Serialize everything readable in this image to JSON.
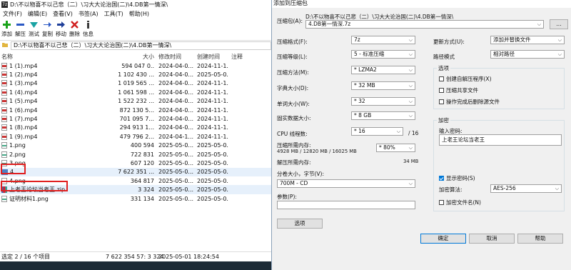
{
  "file_manager": {
    "title": "D:\\不以物喜不以己悲（二）\\习大大论治国(二)\\4.DB第一情深\\",
    "menu": [
      "文件(F)",
      "编辑(E)",
      "查看(V)",
      "书签(A)",
      "工具(T)",
      "帮助(H)"
    ],
    "toolbar": [
      {
        "label": "添加",
        "icon": "add-icon",
        "color": "#1aa31a"
      },
      {
        "label": "解压",
        "icon": "extract-icon",
        "color": "#2a58c4"
      },
      {
        "label": "测试",
        "icon": "test-icon",
        "color": "#1aa3a3"
      },
      {
        "label": "复制",
        "icon": "copy-icon",
        "color": "#2a58c4"
      },
      {
        "label": "移动",
        "icon": "move-icon",
        "color": "#2a58c4"
      },
      {
        "label": "删除",
        "icon": "delete-icon",
        "color": "#d01f1f"
      },
      {
        "label": "信息",
        "icon": "info-icon",
        "color": "#3a3a3a"
      }
    ],
    "path": "D:\\不以物喜不以己悲（二）\\习大大论治国(二)\\4.DB第一情深\\",
    "columns": {
      "name": "名称",
      "size": "大小",
      "modified": "修改时间",
      "created": "创建时间",
      "comment": "注释"
    },
    "rows": [
      {
        "name": "1 (1).mp4",
        "type": "mp4",
        "size": "594 047 0..",
        "modified": "2024-04-0...",
        "created": "2024-11-1..."
      },
      {
        "name": "1 (2).mp4",
        "type": "mp4",
        "size": "1 102 430 ...",
        "modified": "2024-04-0...",
        "created": "2025-05-0..."
      },
      {
        "name": "1 (3).mp4",
        "type": "mp4",
        "size": "1 019 565 ...",
        "modified": "2024-04-0...",
        "created": "2024-11-1..."
      },
      {
        "name": "1 (4).mp4",
        "type": "mp4",
        "size": "1 061 598 ...",
        "modified": "2024-04-0...",
        "created": "2024-11-1..."
      },
      {
        "name": "1 (5).mp4",
        "type": "mp4",
        "size": "1 522 232 ...",
        "modified": "2024-04-0...",
        "created": "2024-11-1..."
      },
      {
        "name": "1 (6).mp4",
        "type": "mp4",
        "size": "872 130 5...",
        "modified": "2024-04-0...",
        "created": "2024-11-1..."
      },
      {
        "name": "1 (7).mp4",
        "type": "mp4",
        "size": "701 095 7...",
        "modified": "2024-04-0...",
        "created": "2024-11-1..."
      },
      {
        "name": "1 (8).mp4",
        "type": "mp4",
        "size": "294 913 1...",
        "modified": "2024-04-0...",
        "created": "2024-11-1..."
      },
      {
        "name": "1 (9).mp4",
        "type": "mp4",
        "size": "479 796 2...",
        "modified": "2024-04-1...",
        "created": "2024-11-1..."
      },
      {
        "name": "1.png",
        "type": "png",
        "size": "400 594",
        "modified": "2025-05-0...",
        "created": "2025-05-0..."
      },
      {
        "name": "2.png",
        "type": "png",
        "size": "722 831",
        "modified": "2025-05-0...",
        "created": "2025-05-0..."
      },
      {
        "name": "3.png",
        "type": "png",
        "size": "607 120",
        "modified": "2025-05-0...",
        "created": "2025-05-0..."
      },
      {
        "name": "4",
        "type": "folder",
        "size": "7 622 351 ...",
        "modified": "2025-05-0...",
        "created": "2025-05-0..."
      },
      {
        "name": "4.png",
        "type": "png",
        "size": "364 817",
        "modified": "2025-05-0...",
        "created": "2025-05-0..."
      },
      {
        "name": "上老王论坛当老王.zip",
        "type": "zip",
        "size": "3 324",
        "modified": "2025-05-0...",
        "created": "2025-05-0..."
      },
      {
        "name": "证明材料1.png",
        "type": "png",
        "size": "331 134",
        "modified": "2025-05-0...",
        "created": "2025-05-0..."
      }
    ],
    "status": {
      "selection": "选定 2 / 16 个项目",
      "size": "7 622 354 57: 3 324",
      "date": "2025-05-01 18:24:54"
    }
  },
  "dialog": {
    "title": "添加到压缩包",
    "archive_label": "压缩包(A):",
    "archive_dir": "D:\\不以物喜不以己悲（二）\\习大大论治国(二)\\4.DB第一情深\\",
    "archive_name": "4.DB第一情深.7z",
    "browse_label": "...",
    "format_label": "压缩格式(F):",
    "format_value": "7z",
    "level_label": "压缩等级(L):",
    "level_value": "5 - 标准压缩",
    "method_label": "压缩方法(M):",
    "method_value": "* LZMA2",
    "dict_label": "字典大小(D):",
    "dict_value": "* 32 MB",
    "word_label": "单词大小(W):",
    "word_value": "* 32",
    "solid_label": "固实数据大小:",
    "solid_value": "* 8 GB",
    "threads_label": "CPU 线程数:",
    "threads_value": "* 16",
    "threads_max": "/ 16",
    "mem_comp_label": "压缩所需内存:",
    "mem_comp_value": "4928 MB / 12820 MB / 16025 MB",
    "mem_pct": "* 80%",
    "mem_decomp_label": "解压所需内存:",
    "mem_decomp_value": "34 MB",
    "split_label": "分卷大小，字节(V):",
    "split_value": "700M - CD",
    "params_label": "参数(P):",
    "params_value": "",
    "options_button": "选项",
    "update_label": "更新方式(U):",
    "update_value": "添加并替换文件",
    "path_label": "路径模式",
    "path_value": "相对路径",
    "options_group": "选项",
    "opt_sfx": "创建自解压程序(X)",
    "opt_shared": "压缩共享文件",
    "opt_delete": "操作完成后删除源文件",
    "encrypt_group": "加密",
    "password_label": "输入密码:",
    "password_value": "上老王论坛当老王",
    "show_password": "显示密码(S)",
    "enc_method_label": "加密算法:",
    "enc_method_value": "AES-256",
    "encrypt_names": "加密文件名(N)",
    "ok_button": "确定",
    "cancel_button": "取消",
    "help_button": "帮助"
  }
}
